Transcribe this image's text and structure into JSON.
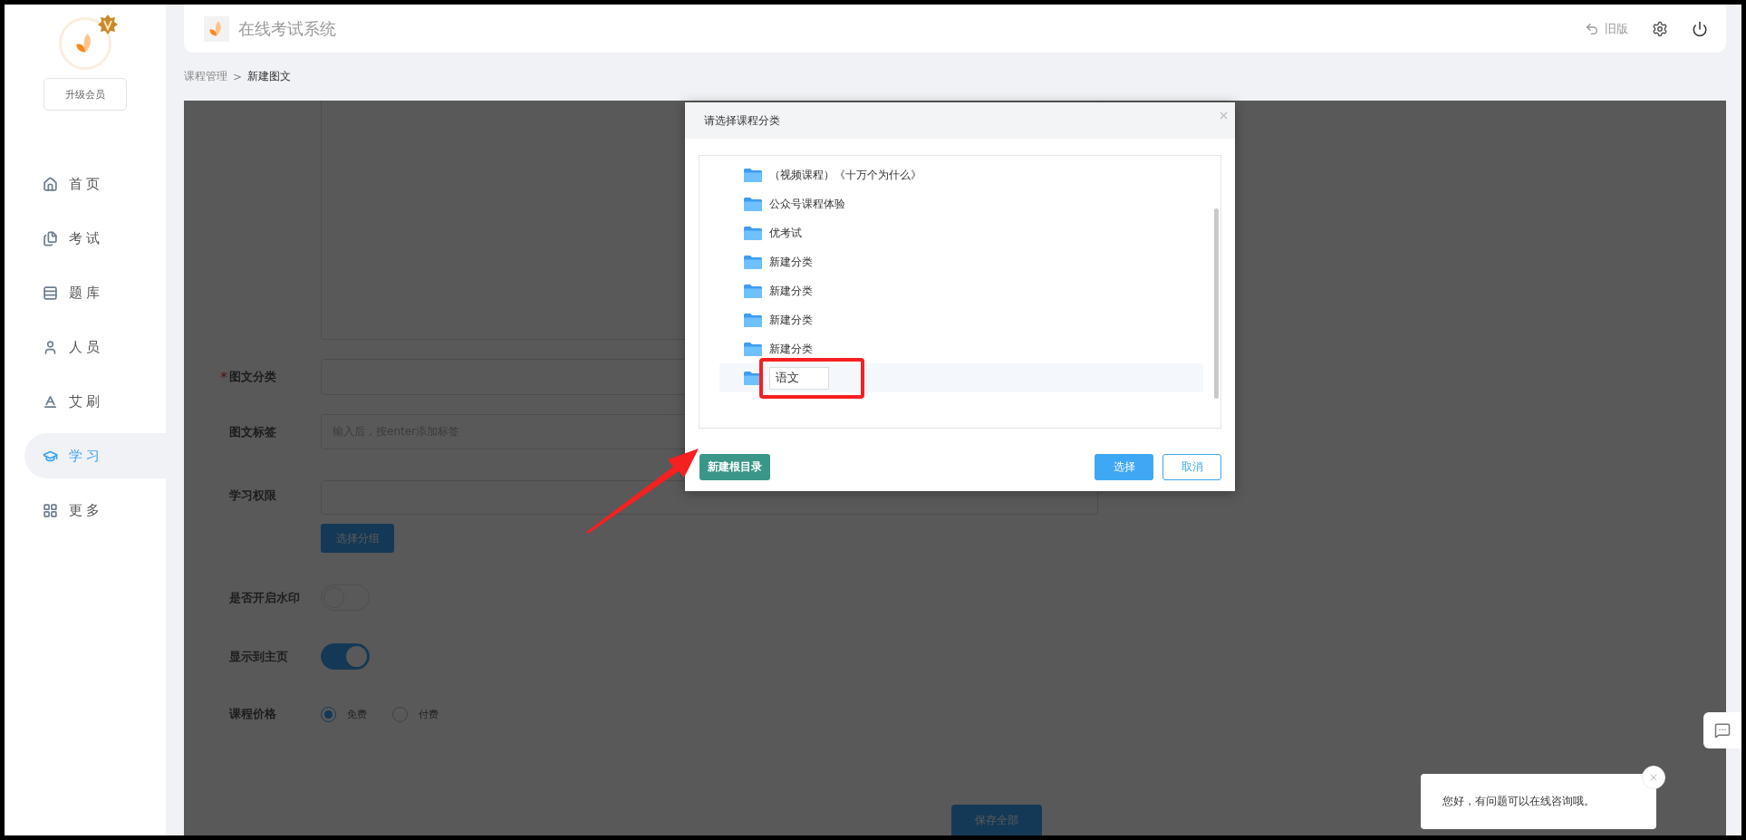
{
  "sidebar": {
    "upgrade_button": "升级会员",
    "items": [
      {
        "label": "首页",
        "selected": false
      },
      {
        "label": "考试",
        "selected": false
      },
      {
        "label": "题库",
        "selected": false
      },
      {
        "label": "人员",
        "selected": false
      },
      {
        "label": "艾刷",
        "selected": false
      },
      {
        "label": "学习",
        "selected": true
      },
      {
        "label": "更多",
        "selected": false
      }
    ]
  },
  "header": {
    "title": "在线考试系统",
    "old_version": "旧版"
  },
  "breadcrumb": {
    "items": [
      "课程管理",
      "新建图文"
    ],
    "separator": ">"
  },
  "form": {
    "fields": [
      {
        "kind": "select",
        "label": "图文分类",
        "required_mark": "*"
      },
      {
        "kind": "input",
        "label": "图文标签",
        "placeholder": "输入后，按enter添加标签"
      },
      {
        "kind": "group",
        "label": "学习权限",
        "button": "选择分组"
      },
      {
        "kind": "switch",
        "label": "是否开启水印",
        "on": false
      },
      {
        "kind": "switch",
        "label": "显示到主页",
        "on": true
      },
      {
        "kind": "radio",
        "label": "课程价格",
        "options": [
          {
            "label": "免费",
            "selected": true
          },
          {
            "label": "付费",
            "selected": false
          }
        ]
      }
    ],
    "save_button": "保存全部"
  },
  "dialog": {
    "title": "请选择课程分类",
    "folders": [
      {
        "kind": "folder",
        "name": "（视频课程）《十万个为什么》"
      },
      {
        "kind": "folder",
        "name": "公众号课程体验"
      },
      {
        "kind": "folder",
        "name": "优考试"
      },
      {
        "kind": "folder",
        "name": "新建分类"
      },
      {
        "kind": "folder",
        "name": "新建分类"
      },
      {
        "kind": "folder",
        "name": "新建分类"
      },
      {
        "kind": "folder",
        "name": "新建分类"
      },
      {
        "kind": "editing",
        "name": "语文"
      }
    ],
    "new_root_button": "新建根目录",
    "select_button": "选择",
    "cancel_button": "取消"
  },
  "chat": {
    "message": "您好，有问题可以在线咨询哦。"
  }
}
